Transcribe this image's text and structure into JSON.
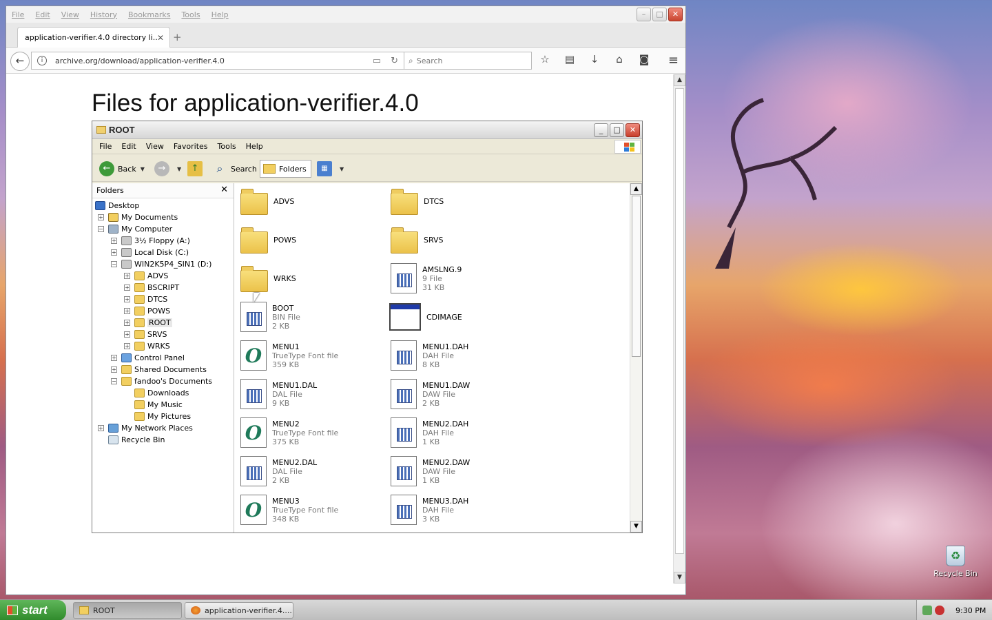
{
  "firefox": {
    "menubar": [
      "File",
      "Edit",
      "View",
      "History",
      "Bookmarks",
      "Tools",
      "Help"
    ],
    "tab_title": "application-verifier.4.0 directory li...",
    "url": "archive.org/download/application-verifier.4.0",
    "search_placeholder": "Search",
    "page_title": "Files for application-verifier.4.0"
  },
  "explorer": {
    "title": "ROOT",
    "menu": [
      "File",
      "Edit",
      "View",
      "Favorites",
      "Tools",
      "Help"
    ],
    "toolbar": {
      "back": "Back",
      "search": "Search",
      "folders": "Folders"
    },
    "folders_pane_title": "Folders",
    "tree": [
      {
        "label": "Desktop"
      },
      {
        "label": "My Documents"
      },
      {
        "label": "My Computer"
      },
      {
        "label": "3½ Floppy (A:)"
      },
      {
        "label": "Local Disk (C:)"
      },
      {
        "label": "WIN2K5P4_SIN1 (D:)"
      },
      {
        "label": "ADVS"
      },
      {
        "label": "BSCRIPT"
      },
      {
        "label": "DTCS"
      },
      {
        "label": "POWS"
      },
      {
        "label": "ROOT"
      },
      {
        "label": "SRVS"
      },
      {
        "label": "WRKS"
      },
      {
        "label": "Control Panel"
      },
      {
        "label": "Shared Documents"
      },
      {
        "label": "fandoo's Documents"
      },
      {
        "label": "Downloads"
      },
      {
        "label": "My Music"
      },
      {
        "label": "My Pictures"
      },
      {
        "label": "My Network Places"
      },
      {
        "label": "Recycle Bin"
      }
    ],
    "files": [
      {
        "name": "ADVS",
        "type": "",
        "size": ""
      },
      {
        "name": "DTCS",
        "type": "",
        "size": ""
      },
      {
        "name": "POWS",
        "type": "",
        "size": ""
      },
      {
        "name": "SRVS",
        "type": "",
        "size": ""
      },
      {
        "name": "WRKS",
        "type": "",
        "size": ""
      },
      {
        "name": "AMSLNG.9",
        "type": "9 File",
        "size": "31 KB"
      },
      {
        "name": "BOOT",
        "type": "BIN File",
        "size": "2 KB"
      },
      {
        "name": "CDIMAGE",
        "type": "",
        "size": ""
      },
      {
        "name": "MENU1",
        "type": "TrueType Font file",
        "size": "359 KB"
      },
      {
        "name": "MENU1.DAH",
        "type": "DAH File",
        "size": "8 KB"
      },
      {
        "name": "MENU1.DAL",
        "type": "DAL File",
        "size": "9 KB"
      },
      {
        "name": "MENU1.DAW",
        "type": "DAW File",
        "size": "2 KB"
      },
      {
        "name": "MENU2",
        "type": "TrueType Font file",
        "size": "375 KB"
      },
      {
        "name": "MENU2.DAH",
        "type": "DAH File",
        "size": "1 KB"
      },
      {
        "name": "MENU2.DAL",
        "type": "DAL File",
        "size": "2 KB"
      },
      {
        "name": "MENU2.DAW",
        "type": "DAW File",
        "size": "1 KB"
      },
      {
        "name": "MENU3",
        "type": "TrueType Font file",
        "size": "348 KB"
      },
      {
        "name": "MENU3.DAH",
        "type": "DAH File",
        "size": "3 KB"
      }
    ]
  },
  "desktop": {
    "recycle_bin": "Recycle Bin"
  },
  "taskbar": {
    "start": "start",
    "tasks": [
      "ROOT",
      "application-verifier.4...."
    ],
    "clock": "9:30 PM"
  }
}
